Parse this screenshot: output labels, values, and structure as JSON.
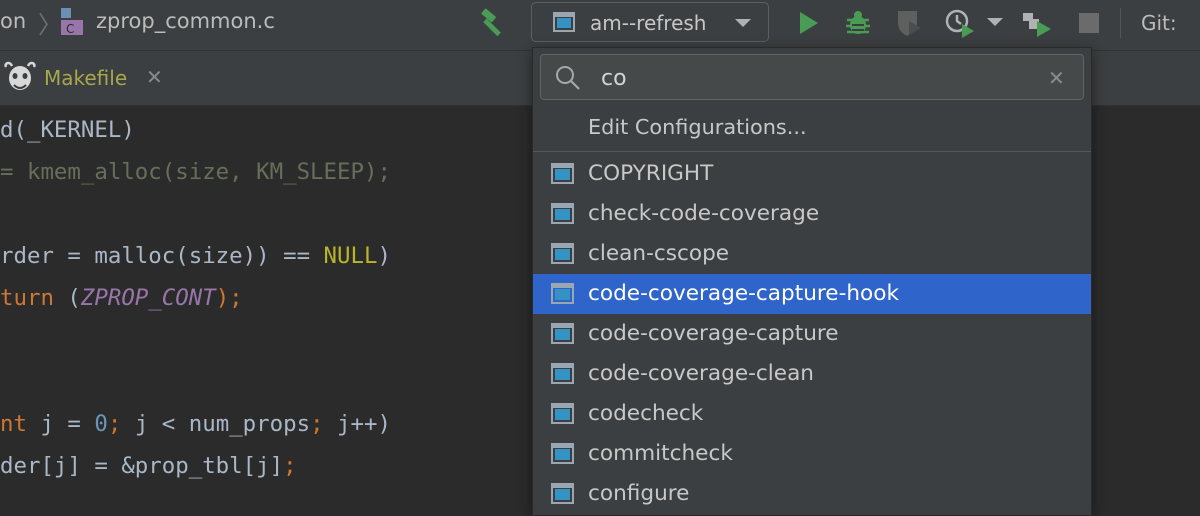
{
  "breadcrumb": {
    "parent": "on",
    "file": "zprop_common.c",
    "file_icon_letter": "C"
  },
  "toolbar": {
    "run_config_label": "am--refresh",
    "git_label": "Git:",
    "icons": [
      "build-hammer-icon",
      "run-icon",
      "debug-icon",
      "coverage-icon",
      "profile-icon",
      "attach-icon",
      "stop-icon"
    ]
  },
  "tab": {
    "label": "Makefile",
    "close": "✕"
  },
  "code": {
    "lines": [
      [
        {
          "t": "d(_KERNEL)",
          "c": "pl"
        }
      ],
      [
        {
          "t": "= kmem_alloc(size, KM_SLEEP);",
          "c": "cm"
        }
      ],
      [],
      [
        {
          "t": "rder = malloc(size)) == ",
          "c": "pl"
        },
        {
          "t": "NULL",
          "c": "yl"
        },
        {
          "t": ")",
          "c": "pl"
        }
      ],
      [
        {
          "t": "turn ",
          "c": "kw"
        },
        {
          "t": "(",
          "c": "pl"
        },
        {
          "t": "ZPROP_CONT",
          "c": "pp"
        },
        {
          "t": ");",
          "c": "kw"
        }
      ],
      [],
      [],
      [
        {
          "t": "nt ",
          "c": "kw"
        },
        {
          "t": "j = ",
          "c": "pl"
        },
        {
          "t": "0",
          "c": "nm"
        },
        {
          "t": "; ",
          "c": "kw"
        },
        {
          "t": "j < num_props",
          "c": "pl"
        },
        {
          "t": "; ",
          "c": "kw"
        },
        {
          "t": "j++)",
          "c": "pl"
        }
      ],
      [
        {
          "t": "der[j] = &prop_tbl[j]",
          "c": "pl"
        },
        {
          "t": ";",
          "c": "kw"
        }
      ]
    ]
  },
  "popup": {
    "search": {
      "value": "co",
      "clear": "✕"
    },
    "edit_configurations": "Edit Configurations...",
    "items": [
      {
        "label": "COPYRIGHT",
        "selected": false
      },
      {
        "label": "check-code-coverage",
        "selected": false
      },
      {
        "label": "clean-cscope",
        "selected": false
      },
      {
        "label": "code-coverage-capture-hook",
        "selected": true
      },
      {
        "label": "code-coverage-capture",
        "selected": false
      },
      {
        "label": "code-coverage-clean",
        "selected": false
      },
      {
        "label": "codecheck",
        "selected": false
      },
      {
        "label": "commitcheck",
        "selected": false
      },
      {
        "label": "configure",
        "selected": false
      }
    ]
  },
  "colors": {
    "selection": "#2f65ca",
    "run_green": "#499c54",
    "tab_label": "#a6a84b",
    "keyword": "#cc7832",
    "macro": "#9876aa"
  }
}
